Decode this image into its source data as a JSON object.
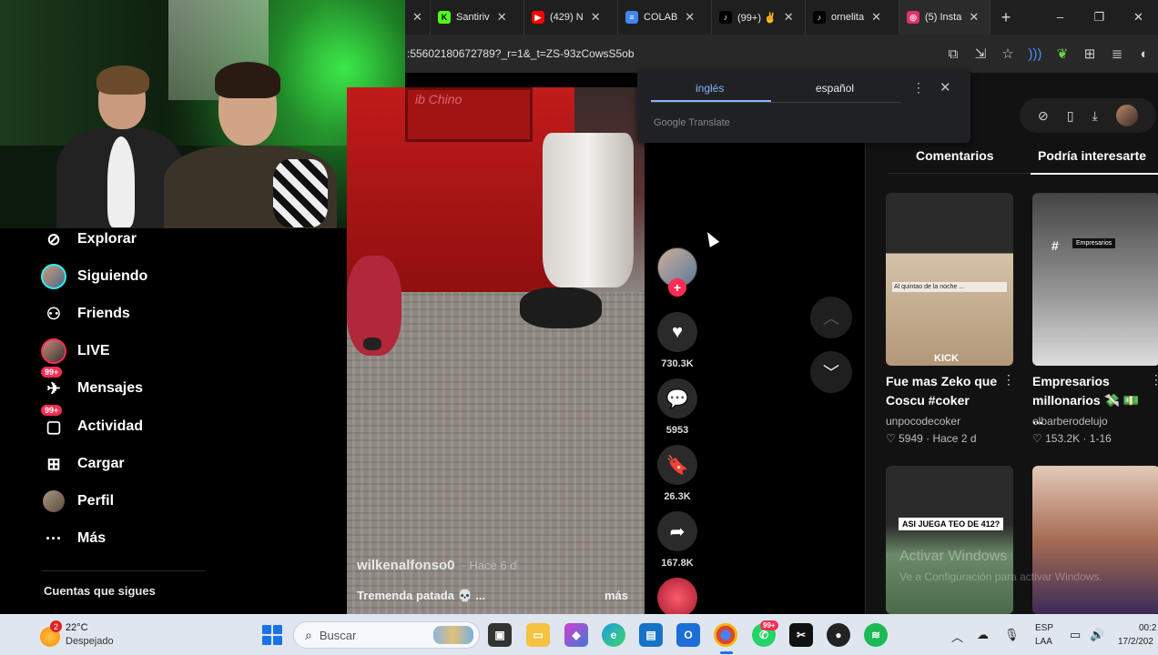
{
  "browser": {
    "tabs": [
      {
        "label": "",
        "icon": "close-icon"
      },
      {
        "label": "Santiriv",
        "icon": "kick-icon",
        "color": "#53fc18"
      },
      {
        "label": "(429) N",
        "icon": "youtube-icon",
        "color": "#ff0000"
      },
      {
        "label": "COLAB",
        "icon": "docs-icon",
        "color": "#4285f4"
      },
      {
        "label": "(99+) ✌",
        "icon": "tiktok-icon",
        "color": "#000000"
      },
      {
        "label": "ornelita",
        "icon": "tiktok-icon",
        "color": "#000000"
      },
      {
        "label": "(5) Insta",
        "icon": "instagram-icon",
        "color": "#e1306c"
      }
    ],
    "new_tab": "+",
    "window_controls": [
      "–",
      "❐",
      "✕"
    ],
    "url": ":55602180672789?_r=1&_t=ZS-93zCowsS5ob"
  },
  "translate_popup": {
    "source_lang": "inglés",
    "target_lang": "español",
    "provider": "Google Translate",
    "menu": "⋮",
    "close": "✕"
  },
  "sidebar": {
    "items": [
      {
        "label": "Explorar",
        "icon": "compass-icon"
      },
      {
        "label": "Siguiendo",
        "icon": "following-avatar-icon"
      },
      {
        "label": "Friends",
        "icon": "friends-icon"
      },
      {
        "label": "LIVE",
        "icon": "live-avatar-icon"
      },
      {
        "label": "Mensajes",
        "icon": "messages-icon",
        "badge": "99+"
      },
      {
        "label": "Actividad",
        "icon": "activity-icon",
        "badge": "99+"
      },
      {
        "label": "Cargar",
        "icon": "upload-icon"
      },
      {
        "label": "Perfil",
        "icon": "profile-avatar-icon"
      },
      {
        "label": "Más",
        "icon": "more-dots-icon"
      }
    ],
    "following_title": "Cuentas que sigues"
  },
  "video": {
    "author": "wilkenalfonso0",
    "time": "· Hace 6 d",
    "description": "Tremenda patada 💀 ...",
    "more": "más",
    "likes": "730.3K",
    "comments": "5953",
    "saves": "26.3K",
    "shares": "167.8K",
    "sign": "ib Chino"
  },
  "right_panel": {
    "tab_comments": "Comentarios",
    "tab_related": "Podría interesarte",
    "videos": [
      {
        "title": "Fue mas Zeko que Coscu #coker",
        "author": "unpocodecoker",
        "likes": "♡ 5949",
        "date": "· Hace 2 d",
        "overlay": "KICK",
        "caption": "Al quintao de la noche ..."
      },
      {
        "title": "Empresarios millonarios 💸 💵 ...",
        "author": "elbarberodelujo",
        "likes": "♡ 153.2K",
        "date": "· 1-16",
        "overlay": "#"
      },
      {
        "title": "",
        "author": "",
        "likes": "",
        "date": "",
        "overlay": "ASI JUEGA TEO DE 412?"
      },
      {
        "title": "",
        "author": "",
        "likes": "",
        "date": "",
        "overlay": ""
      }
    ],
    "watermark_line1": "Activar Windows",
    "watermark_line2": "Ve a Configuración para activar Windows."
  },
  "taskbar": {
    "temperature": "22°C",
    "condition": "Despejado",
    "weather_badge": "2",
    "search_placeholder": "Buscar",
    "whatsapp_badge": "99+",
    "lang_line1": "ESP",
    "lang_line2": "LAA",
    "time": "00:2",
    "date": "17/2/202"
  },
  "colors": {
    "tiktok_red": "#fe2c55",
    "tiktok_cyan": "#25f4ee",
    "taskbar_bg": "#dfe6ef",
    "translate_accent": "#8ab4f8"
  }
}
